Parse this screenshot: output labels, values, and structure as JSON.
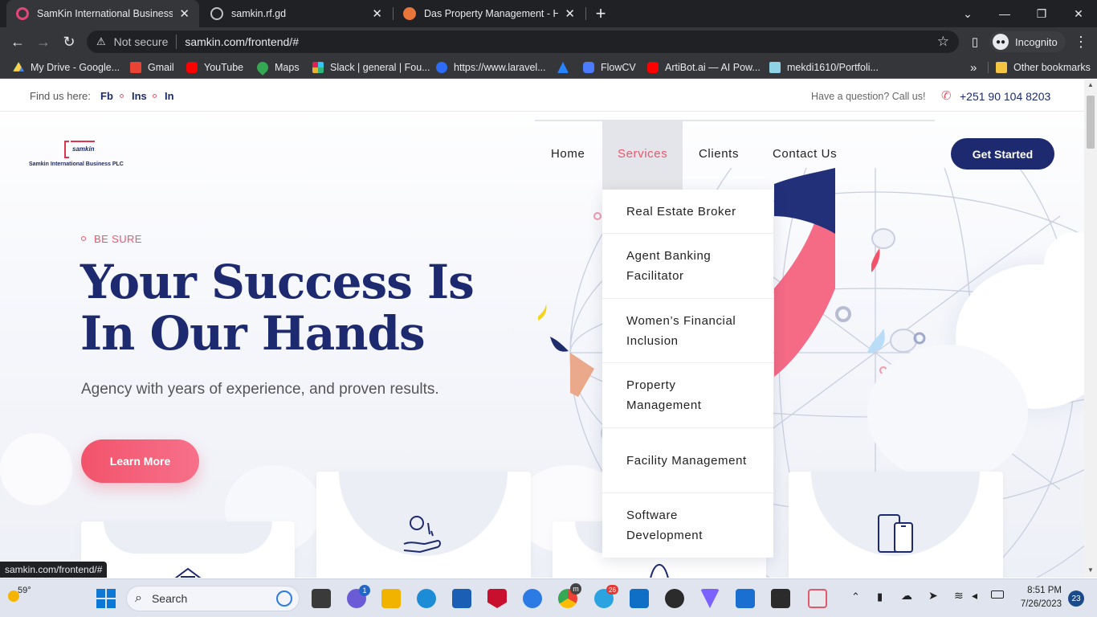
{
  "browser": {
    "tabs": [
      {
        "title": "SamKin International Business PLC",
        "active": true
      },
      {
        "title": "samkin.rf.gd",
        "active": false
      },
      {
        "title": "Das Property Management - Home",
        "active": false
      }
    ],
    "new_tab_glyph": "+",
    "address": {
      "security": "Not secure",
      "url": "samkin.com/frontend/#"
    },
    "profile_label": "Incognito",
    "bookmarks": [
      {
        "label": "My Drive - Google...",
        "icon": "google-drive-icon"
      },
      {
        "label": "Gmail",
        "icon": "gmail-icon"
      },
      {
        "label": "YouTube",
        "icon": "youtube-icon"
      },
      {
        "label": "Maps",
        "icon": "maps-icon"
      },
      {
        "label": "Slack | general | Fou...",
        "icon": "slack-icon"
      },
      {
        "label": "https://www.laravel...",
        "icon": "link-icon"
      },
      {
        "label": "",
        "icon": "atlassian-icon"
      },
      {
        "label": "FlowCV",
        "icon": "flowcv-icon"
      },
      {
        "label": "ArtiBot.ai — AI Pow...",
        "icon": "youtube-icon"
      },
      {
        "label": "mekdi1610/Portfoli...",
        "icon": "github-icon"
      }
    ],
    "bookmarks_overflow": "»",
    "other_bookmarks": "Other bookmarks",
    "status_url": "samkin.com/frontend/#"
  },
  "site": {
    "topbar": {
      "find_label": "Find us here:",
      "socials": [
        "Fb",
        "Ins",
        "In"
      ],
      "question": "Have a question? Call us!",
      "phone": "+251 90 104 8203"
    },
    "logo": {
      "wordmark": "samkin",
      "company": "Samkin International Business PLC"
    },
    "nav": {
      "items": [
        "Home",
        "Services",
        "Clients",
        "Contact Us"
      ],
      "active": "Services",
      "cta": "Get Started"
    },
    "dropdown": [
      "Real Estate Broker",
      "Agent Banking Facilitator",
      "Women’s Financial Inclusion",
      "Property Management",
      "Facility Management",
      "Software Development"
    ],
    "hero": {
      "eyebrow": "BE SURE",
      "title_line1": "Your Success Is",
      "title_line2": "In Our Hands",
      "subtitle": "Agency with years of experience, and proven results.",
      "button": "Learn More"
    },
    "cards": [
      "house-icon",
      "hand-coin-icon",
      "person-icon",
      "mobile-devices-icon"
    ]
  },
  "taskbar": {
    "weather": "59°",
    "search_placeholder": "Search",
    "time": "8:51 PM",
    "date": "7/26/2023",
    "notifications": "23",
    "badges": {
      "chat": "1",
      "telegram": "26",
      "chrome": "m"
    }
  },
  "colors": {
    "navy": "#1d2a6f",
    "pink": "#f2536b",
    "accent_link": "#1b2a6b"
  }
}
